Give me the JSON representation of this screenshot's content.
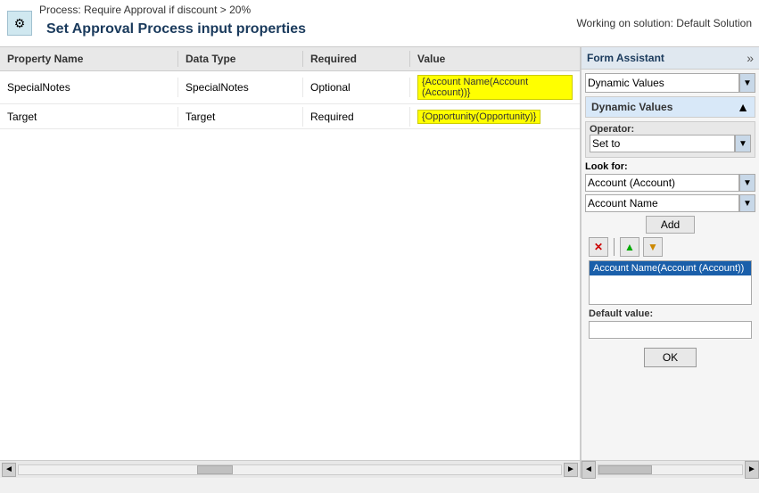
{
  "topBar": {
    "processLabel": "Process: Require Approval if discount > 20%",
    "workingOn": "Working on solution: Default Solution",
    "pageTitle": "Set Approval Process input properties"
  },
  "table": {
    "headers": {
      "propertyName": "Property Name",
      "dataType": "Data Type",
      "required": "Required",
      "value": "Value"
    },
    "rows": [
      {
        "propertyName": "SpecialNotes",
        "dataType": "SpecialNotes",
        "required": "Optional",
        "value": "{Account Name(Account (Account))}"
      },
      {
        "propertyName": "Target",
        "dataType": "Target",
        "required": "Required",
        "value": "{Opportunity(Opportunity)}"
      }
    ]
  },
  "formAssistant": {
    "title": "Form Assistant",
    "expandIcon": "»",
    "dynamicValuesLabel": "Dynamic Values",
    "sectionLabel": "Dynamic Values",
    "collapseIcon": "▲",
    "operator": {
      "label": "Operator:",
      "value": "Set to"
    },
    "lookFor": {
      "label": "Look for:",
      "option1": "Account (Account)",
      "option2": "Account Name"
    },
    "addButton": "Add",
    "deleteIcon": "✕",
    "upIcon": "▲",
    "downIcon": "▼",
    "selectedValue": "Account Name(Account (Account))",
    "defaultValue": {
      "label": "Default value:",
      "placeholder": ""
    },
    "okButton": "OK"
  },
  "scrollbar": {
    "leftArrow": "◄",
    "rightArrow": "►"
  }
}
